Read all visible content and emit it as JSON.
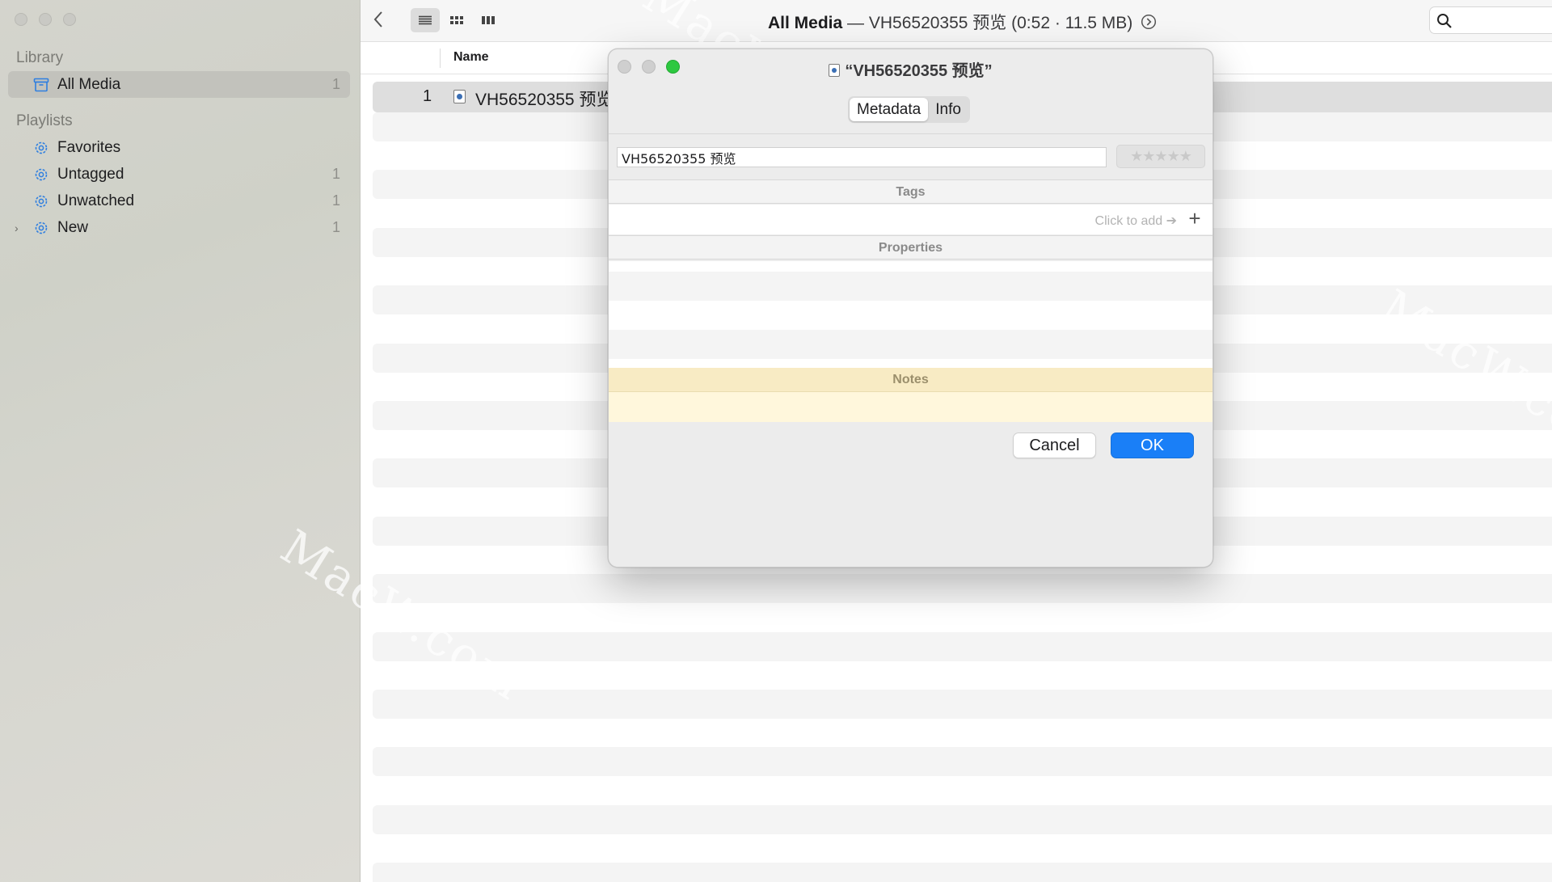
{
  "sidebar": {
    "library_title": "Library",
    "library_items": [
      {
        "label": "All Media",
        "count": "1",
        "icon": "archive-box-icon"
      }
    ],
    "playlists_title": "Playlists",
    "playlist_items": [
      {
        "label": "Favorites",
        "count": "",
        "icon": "gear-icon"
      },
      {
        "label": "Untagged",
        "count": "1",
        "icon": "gear-icon"
      },
      {
        "label": "Unwatched",
        "count": "1",
        "icon": "gear-icon"
      },
      {
        "label": "New",
        "count": "1",
        "icon": "gear-icon",
        "disclosure": "›"
      }
    ]
  },
  "toolbar": {
    "title_bold": "All Media",
    "title_rest": " — VH56520355 预览 (0:52 · 11.5 MB)",
    "info_icon": "chevron-right-circle-icon",
    "view_modes": [
      "list-view-icon",
      "grid-view-icon",
      "column-view-icon"
    ],
    "active_view": "list-view-icon"
  },
  "table": {
    "columns": [
      "Name"
    ],
    "rows": [
      {
        "index": "1",
        "name": "VH56520355 预览"
      }
    ]
  },
  "dialog": {
    "title": "“VH56520355 预览”",
    "tabs": [
      "Metadata",
      "Info"
    ],
    "active_tab": "Metadata",
    "name_value": "VH56520355 预览",
    "rating": "★★★★★",
    "tags_header": "Tags",
    "tags_hint": "Click to add ➔",
    "tags_add": "+",
    "properties_header": "Properties",
    "add_property": "+",
    "remove_property": "−",
    "notes_header": "Notes",
    "cancel_label": "Cancel",
    "ok_label": "OK"
  },
  "watermark": {
    "text": "MacW.com"
  },
  "colors": {
    "accent": "#1a7ff7",
    "sidebar_bg": "#d4d4cd",
    "notes_bg": "#fff7dc",
    "green_traffic": "#2dc840"
  }
}
